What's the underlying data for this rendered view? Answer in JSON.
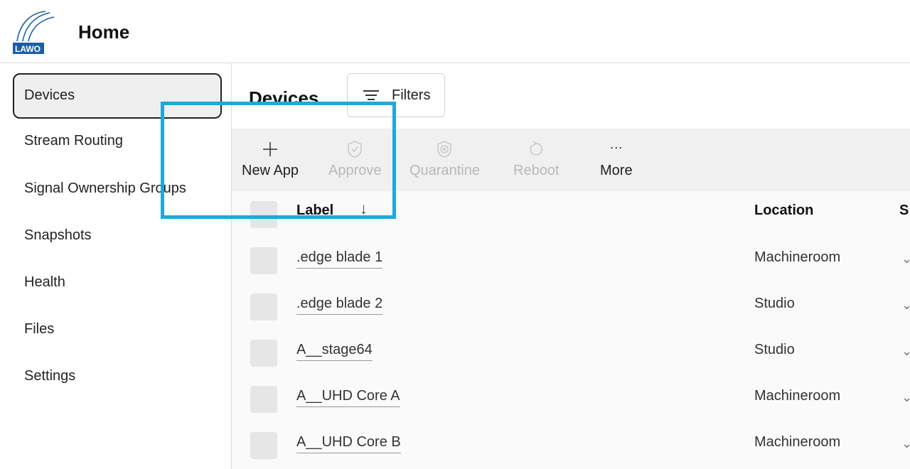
{
  "header": {
    "logo_text": "LAWO",
    "title": "Home"
  },
  "sidebar": {
    "items": [
      {
        "label": "Devices",
        "active": true
      },
      {
        "label": "Stream Routing",
        "active": false
      },
      {
        "label": "Signal Ownership Groups",
        "active": false
      },
      {
        "label": "Snapshots",
        "active": false
      },
      {
        "label": "Health",
        "active": false
      },
      {
        "label": "Files",
        "active": false
      },
      {
        "label": "Settings",
        "active": false
      }
    ]
  },
  "main": {
    "page_title": "Devices",
    "filters_label": "Filters",
    "toolbar": [
      {
        "label": "New App",
        "icon": "plus-icon",
        "enabled": true
      },
      {
        "label": "Approve",
        "icon": "shield-check-icon",
        "enabled": false
      },
      {
        "label": "Quarantine",
        "icon": "shield-x-icon",
        "enabled": false
      },
      {
        "label": "Reboot",
        "icon": "reboot-icon",
        "enabled": false
      },
      {
        "label": "More",
        "icon": "ellipsis-icon",
        "enabled": true
      }
    ],
    "table": {
      "columns": [
        "Label",
        "Location",
        "S"
      ],
      "rows": [
        {
          "label": ".edge blade 1",
          "location": "Machineroom"
        },
        {
          "label": ".edge blade 2",
          "location": "Studio"
        },
        {
          "label": "A__stage64",
          "location": "Studio"
        },
        {
          "label": "A__UHD Core A",
          "location": "Machineroom"
        },
        {
          "label": "A__UHD Core B",
          "location": "Machineroom"
        }
      ]
    }
  },
  "colors": {
    "highlight": "#1ea8dc",
    "logo_blue": "#1a5fa3",
    "toolbar_bg": "#f0f0f0",
    "disabled_text": "#b9b9b9"
  }
}
